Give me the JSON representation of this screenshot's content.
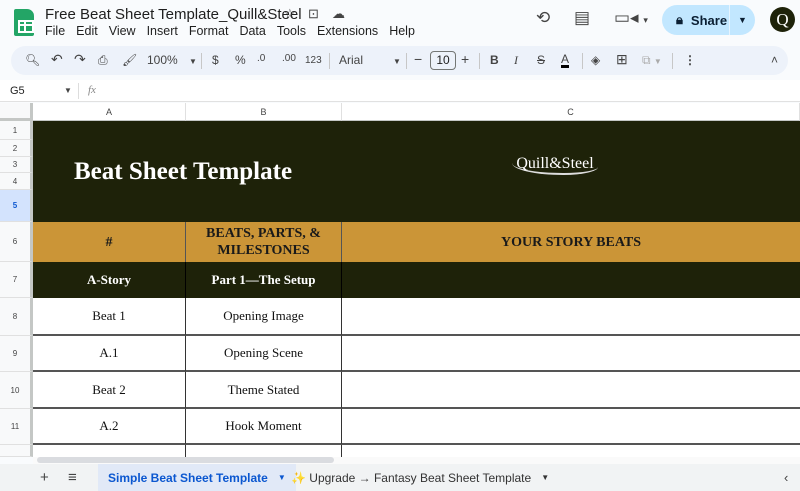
{
  "doc": {
    "title": "Free Beat Sheet Template_Quill&Steel"
  },
  "menu": [
    "File",
    "Edit",
    "View",
    "Insert",
    "Format",
    "Data",
    "Tools",
    "Extensions",
    "Help"
  ],
  "header": {
    "share_label": "Share",
    "avatar_letter": "Q"
  },
  "toolbar": {
    "zoom": "100%",
    "currency": "$",
    "percent": "%",
    "dec_decrease": ".0",
    "dec_increase": ".00",
    "number_format": "123",
    "font": "Arial",
    "font_size": "10"
  },
  "formula_bar": {
    "cell_ref": "G5",
    "fx": "fx",
    "value": ""
  },
  "columns": [
    "A",
    "B",
    "C"
  ],
  "rows": [
    "1",
    "2",
    "3",
    "4",
    "5",
    "6",
    "7",
    "8",
    "9",
    "10",
    "11"
  ],
  "sheet": {
    "title": "Beat Sheet Template",
    "logo": "Quill&Steel",
    "headers": {
      "num": "#",
      "beats": "BEATS, PARTS, & MILESTONES",
      "story": "YOUR STORY BEATS"
    },
    "section": {
      "a": "A-Story",
      "b": "Part 1—The Setup"
    },
    "data": [
      [
        "Beat 1",
        "Opening Image"
      ],
      [
        "A.1",
        "Opening Scene"
      ],
      [
        "Beat 2",
        "Theme Stated"
      ],
      [
        "A.2",
        "Hook Moment"
      ]
    ]
  },
  "tabs": [
    {
      "label": "Simple Beat Sheet Template",
      "active": true
    },
    {
      "label": "✨ Upgrade → Fantasy Beat Sheet Template",
      "active": false
    }
  ],
  "colors": {
    "dark": "#1e2209",
    "gold": "#cb9537",
    "accent": "#0b57d0"
  }
}
